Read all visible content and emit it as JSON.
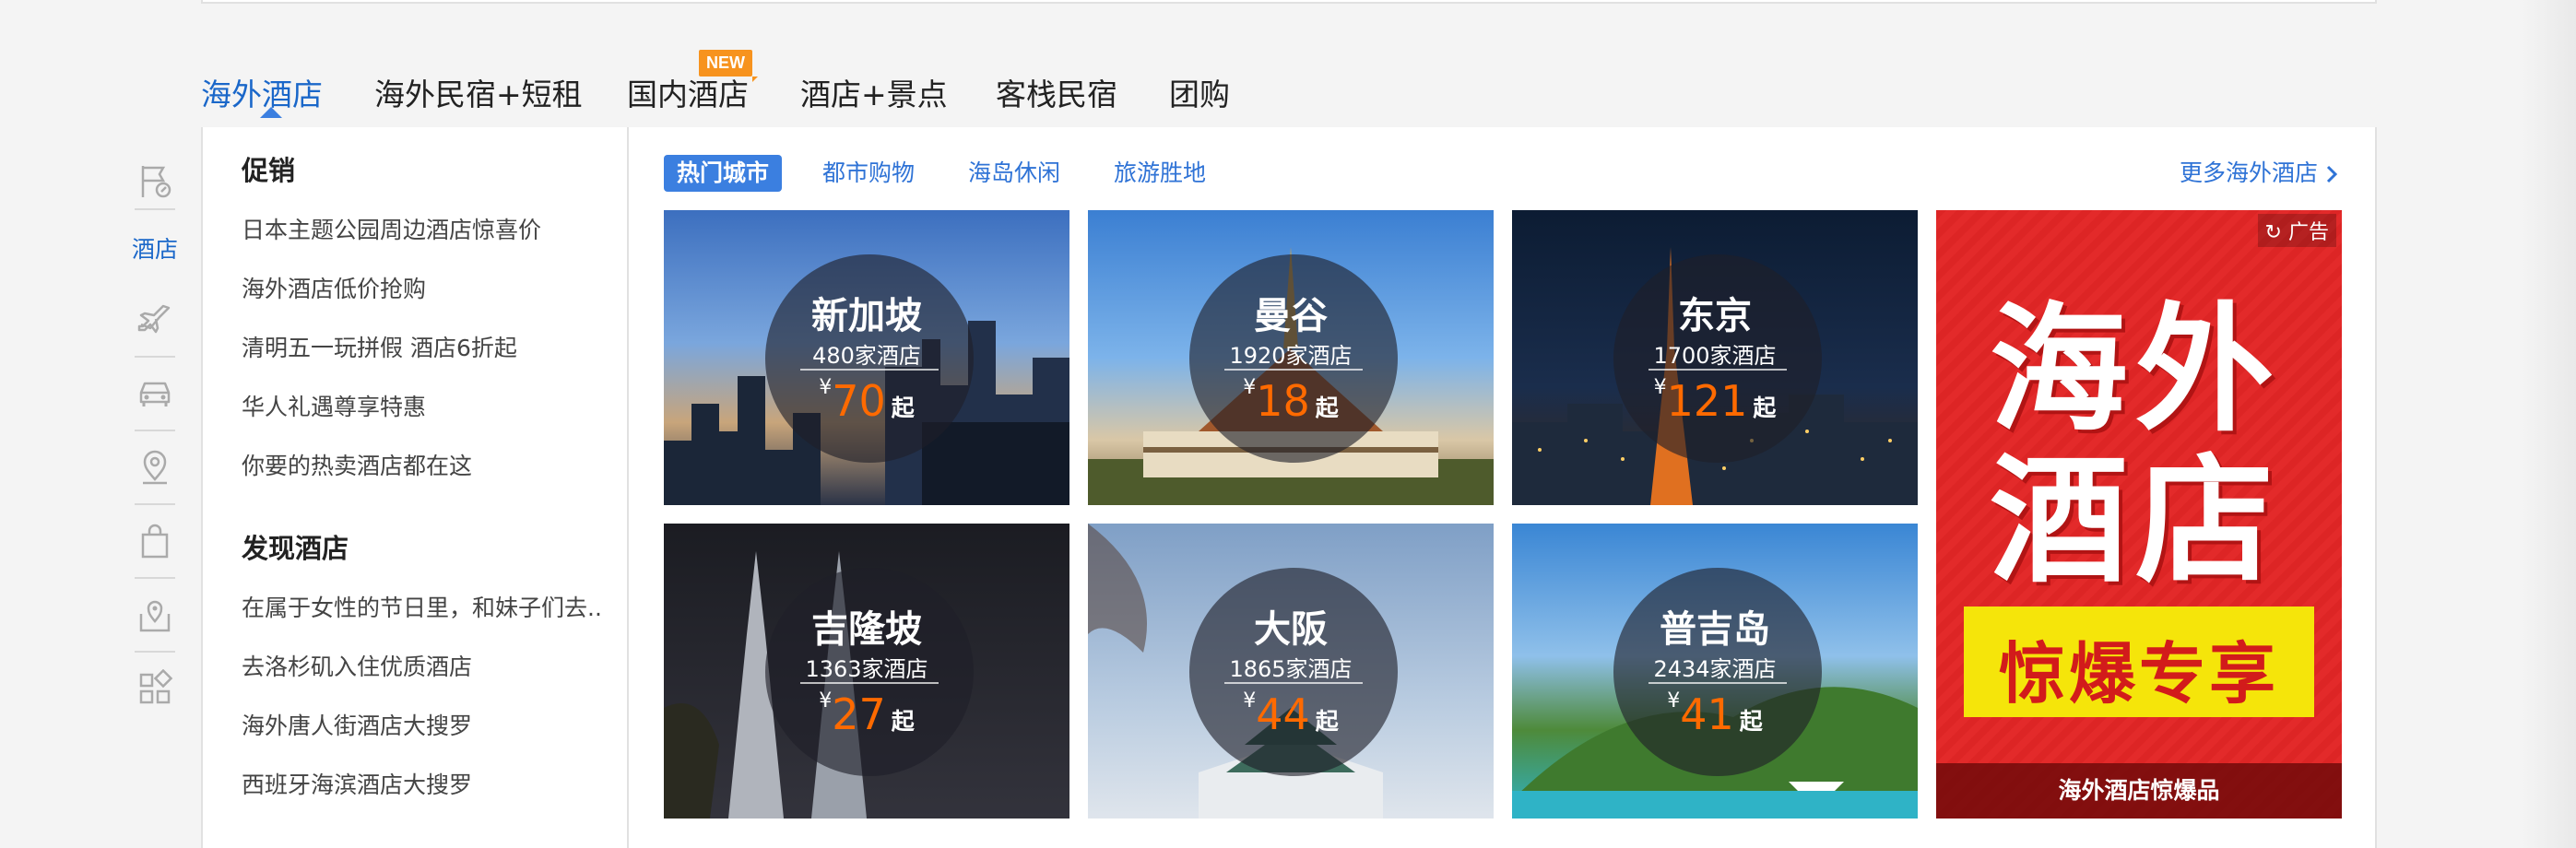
{
  "tabs": [
    {
      "label": "海外酒店"
    },
    {
      "label": "海外民宿+短租",
      "badge": "NEW"
    },
    {
      "label": "国内酒店"
    },
    {
      "label": "酒店+景点"
    },
    {
      "label": "客栈民宿"
    },
    {
      "label": "团购"
    }
  ],
  "rail": {
    "items": [
      "flag-icon",
      "hotel",
      "plane-icon",
      "car-icon",
      "location-pin-icon",
      "shopping-bag-icon",
      "map-pin-icon",
      "grid-icon"
    ],
    "active_label": "酒店"
  },
  "side": {
    "promo_title": "促销",
    "promo_links": [
      "日本主题公园周边酒店惊喜价",
      "海外酒店低价抢购",
      "清明五一玩拼假 酒店6折起",
      "华人礼遇尊享特惠",
      "你要的热卖酒店都在这"
    ],
    "discover_title": "发现酒店",
    "discover_links": [
      "在属于女性的节日里，和妹子们去..",
      "去洛杉矶入住优质酒店",
      "海外唐人街酒店大搜罗",
      "西班牙海滨酒店大搜罗"
    ]
  },
  "subtabs": [
    "热门城市",
    "都市购物",
    "海岛休闲",
    "旅游胜地"
  ],
  "more_link": "更多海外酒店",
  "currency": "¥",
  "qi": "起",
  "cities": [
    {
      "name": "新加坡",
      "count": "480家酒店",
      "price": "70"
    },
    {
      "name": "曼谷",
      "count": "1920家酒店",
      "price": "18"
    },
    {
      "name": "东京",
      "count": "1700家酒店",
      "price": "121"
    },
    {
      "name": "吉隆坡",
      "count": "1363家酒店",
      "price": "27"
    },
    {
      "name": "大阪",
      "count": "1865家酒店",
      "price": "44"
    },
    {
      "name": "普吉岛",
      "count": "2434家酒店",
      "price": "41"
    }
  ],
  "ad": {
    "tag": "广告",
    "line1": "海外",
    "line2": "酒店",
    "banner": "惊爆专享",
    "footer": "海外酒店惊爆品"
  },
  "colors": {
    "accent": "#3b7fe0",
    "price": "#ff6a00",
    "badge": "#f7931e",
    "ad_red": "#e32a2a"
  }
}
